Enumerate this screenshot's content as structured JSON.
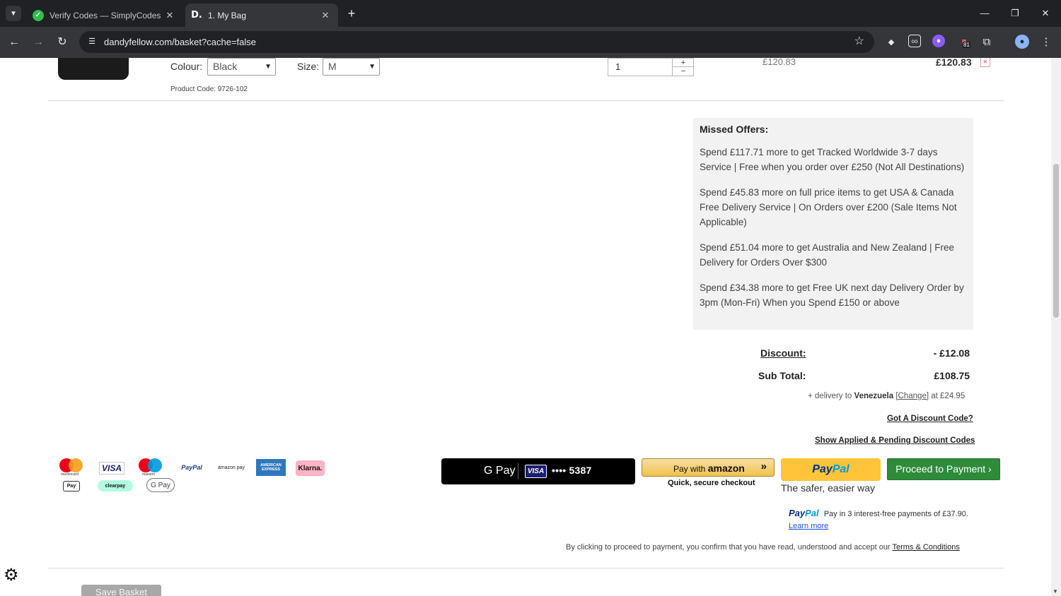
{
  "browser": {
    "tabs": [
      {
        "title": "Verify Codes — SimplyCodes",
        "favicon": "simplycodes-icon"
      },
      {
        "title": "1. My Bag",
        "favicon": "D."
      }
    ],
    "url": "dandyfellow.com/basket?cache=false",
    "extension_badge": "81"
  },
  "basket_item": {
    "colour_label": "Colour:",
    "colour_value": "Black",
    "size_label": "Size:",
    "size_value": "M",
    "product_code": "Product Code: 9726-102",
    "quantity": "1",
    "qty_plus": "+",
    "qty_minus": "−",
    "unit_price": "£120.83",
    "line_total": "£120.83",
    "remove": "×"
  },
  "missed_offers": {
    "title": "Missed Offers:",
    "items": [
      "Spend £117.71 more to get Tracked Worldwide 3-7 days Service | Free when you order over £250 (Not All Destinations)",
      "Spend £45.83 more on full price items to get USA & Canada Free Delivery Service | On Orders over £200 (Sale Items Not Applicable)",
      "Spend £51.04 more to get Australia and New Zealand | Free Delivery for Orders Over $300",
      "Spend £34.38 more to get Free UK next day Delivery Order by 3pm (Mon-Fri) When you Spend £150 or above"
    ]
  },
  "summary": {
    "discount_label": "Discount:",
    "discount_value": "- £12.08",
    "subtotal_label": "Sub Total:",
    "subtotal_value": "£108.75",
    "delivery_prefix": "+ delivery to",
    "delivery_country": "Venezuela",
    "delivery_change": "[Change]",
    "delivery_suffix": "at £24.95",
    "discount_code_link": "Got A Discount Code?",
    "applied_codes_link": "Show Applied & Pending Discount Codes"
  },
  "payment_icons": {
    "mastercard": "mastercard",
    "visa": "VISA",
    "maestro": "maestro",
    "paypal": "PayPal",
    "amazonpay": "amazon pay",
    "amex": "AMERICAN EXPRESS",
    "klarna": "Klarna.",
    "applepay": "Pay",
    "clearpay": "clearpay",
    "gpay": "G Pay"
  },
  "checkout": {
    "gpay_label": "G Pay",
    "gpay_card_brand": "VISA",
    "gpay_card": "•••• 5387",
    "amazon_prefix": "Pay with",
    "amazon_brand": "amazon",
    "amazon_sub": "Quick, secure checkout",
    "paypal_pay": "Pay",
    "paypal_pal": "Pal",
    "paypal_tagline": "The safer, easier way",
    "proceed": "Proceed to Payment ›",
    "paypal_later_logo_pay": "Pay",
    "paypal_later_logo_pal": "Pal",
    "paypal_later_text": "Pay in 3 interest-free payments of £37.90.",
    "paypal_learn_more": "Learn more",
    "terms_text": "By clicking to proceed to payment, you confirm that you have read, understood and accept our",
    "terms_link": "Terms & Conditions"
  },
  "footer": {
    "save_basket": "Save Basket"
  }
}
